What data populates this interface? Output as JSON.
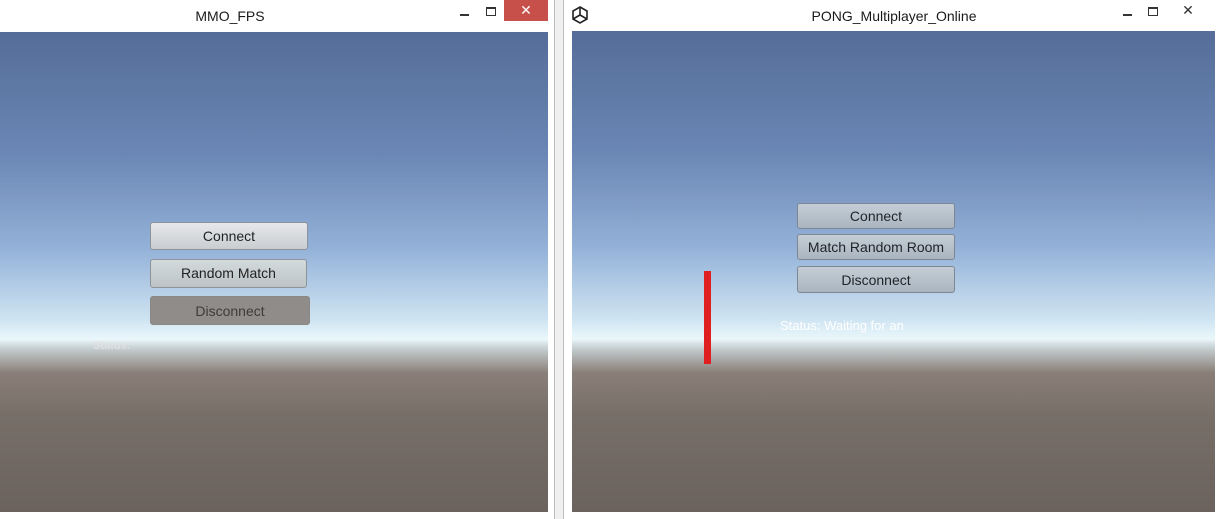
{
  "left_window": {
    "title": "MMO_FPS",
    "controls": {
      "minimize": "—",
      "maximize": "□",
      "close": "✕"
    },
    "buttons": {
      "connect": "Connect",
      "random_match": "Random Match",
      "disconnect": "Disconnect"
    },
    "status_label": "Status:"
  },
  "right_window": {
    "title": "PONG_Multiplayer_Online",
    "controls": {
      "minimize": "—",
      "maximize": "□",
      "close": "✕"
    },
    "buttons": {
      "connect": "Connect",
      "match_random_room": "Match Random Room",
      "disconnect": "Disconnect"
    },
    "status_text": "Status: Waiting for an"
  },
  "colors": {
    "close_button": "#c7504a",
    "paddle": "#e02020",
    "sky_top": "#556d98",
    "ground": "#6b625d"
  }
}
